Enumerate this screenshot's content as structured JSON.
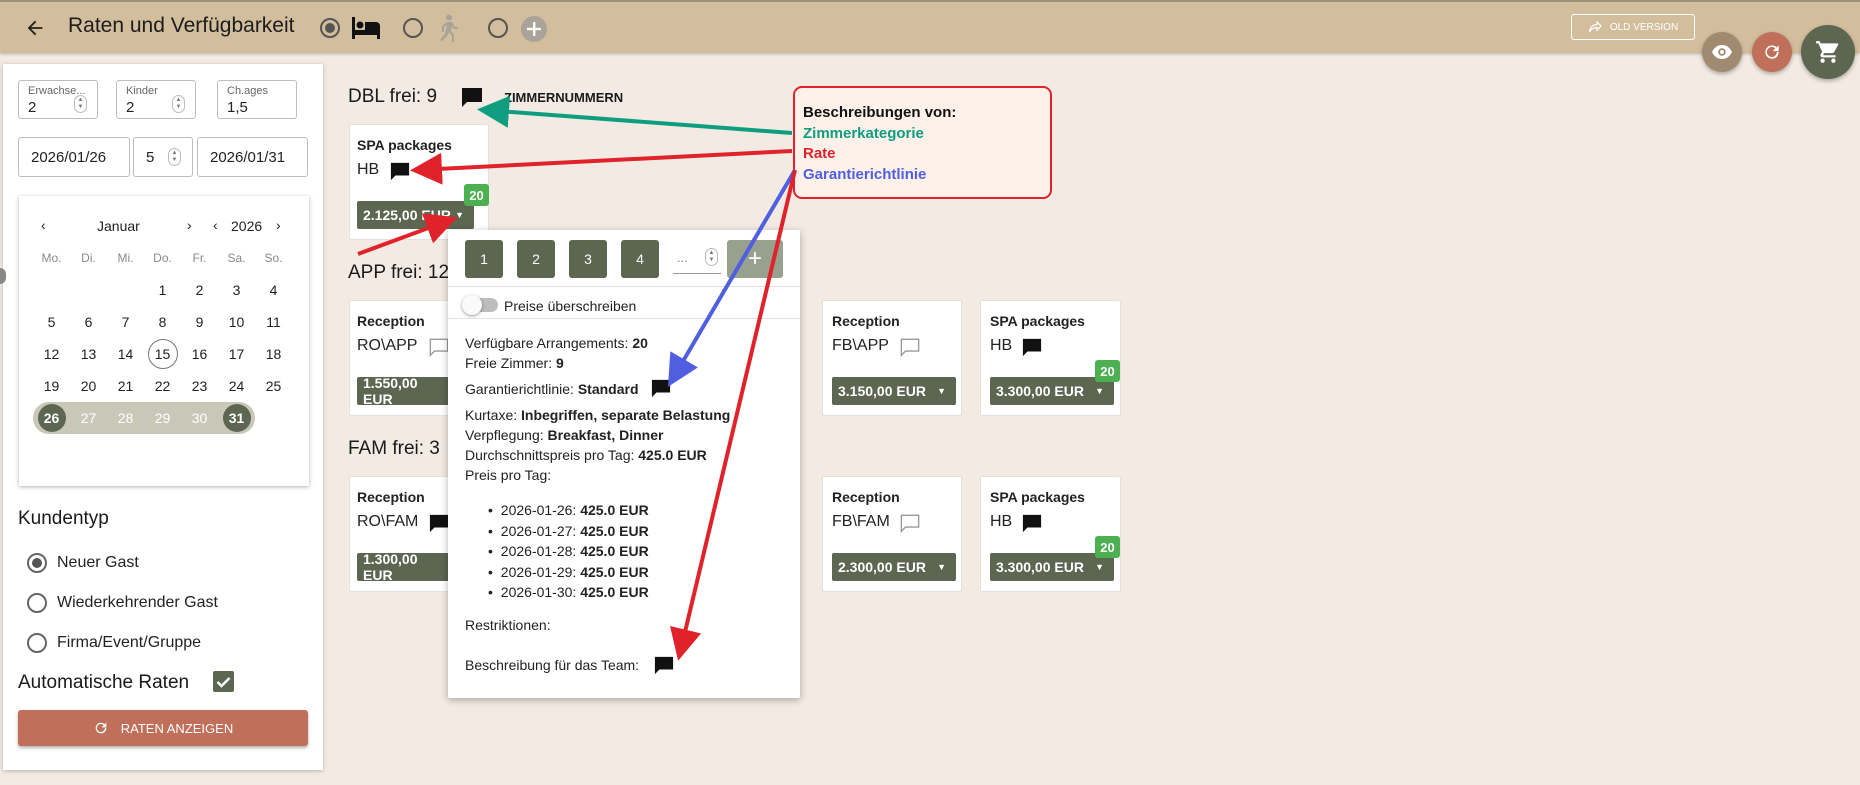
{
  "header": {
    "title": "Raten und Verfügbarkeit",
    "back_icon": "arrow-left-icon",
    "mode_options": [
      {
        "icon": "bed-icon",
        "selected": true
      },
      {
        "icon": "walking-person-icon",
        "selected": false
      },
      {
        "icon": "plus-circle-icon",
        "selected": false
      }
    ],
    "old_version_label": "OLD VERSION",
    "colors": {
      "bar": "#d2be9c",
      "eye_fab": "#a08a70",
      "refresh_fab": "#c0705a",
      "cart_fab": "#5c6651"
    }
  },
  "search": {
    "adults": {
      "label": "Erwachse...",
      "value": "2"
    },
    "children": {
      "label": "Kinder",
      "value": "2"
    },
    "child_ages": {
      "label": "Ch.ages",
      "value": "1,5"
    },
    "arrival": "2026/01/26",
    "nights": "5",
    "departure": "2026/01/31"
  },
  "calendar": {
    "month": "Januar",
    "year": "2026",
    "weekdays": [
      "Mo.",
      "Di.",
      "Mi.",
      "Do.",
      "Fr.",
      "Sa.",
      "So."
    ],
    "weeks": [
      [
        "",
        "",
        "",
        "1",
        "2",
        "3",
        "4"
      ],
      [
        "5",
        "6",
        "7",
        "8",
        "9",
        "10",
        "11"
      ],
      [
        "12",
        "13",
        "14",
        "15",
        "16",
        "17",
        "18"
      ],
      [
        "19",
        "20",
        "21",
        "22",
        "23",
        "24",
        "25"
      ],
      [
        "26",
        "27",
        "28",
        "29",
        "30",
        "31",
        ""
      ]
    ],
    "today": "15",
    "range_start": "26",
    "range_end": "31"
  },
  "customer_type": {
    "title": "Kundentyp",
    "options": [
      {
        "label": "Neuer Gast",
        "selected": true
      },
      {
        "label": "Wiederkehrender Gast",
        "selected": false
      },
      {
        "label": "Firma/Event/Gruppe",
        "selected": false
      }
    ]
  },
  "auto_rates": {
    "label": "Automatische Raten",
    "checked": true
  },
  "show_rates_button": "RATEN ANZEIGEN",
  "categories": {
    "dbl": {
      "title": "DBL frei: 9",
      "room_numbers_label": "ZIMMERNUMMERN",
      "cards": [
        {
          "name": "SPA packages",
          "rate": "HB",
          "price": "2.125,00 EUR",
          "badge": "20"
        }
      ]
    },
    "app": {
      "title": "APP frei: 12",
      "cards": [
        {
          "name": "Reception",
          "rate": "RO\\APP",
          "price": "1.550,00 EUR"
        },
        {
          "name": "Reception",
          "rate": "FB\\APP",
          "price": "3.150,00 EUR"
        },
        {
          "name": "SPA packages",
          "rate": "HB",
          "price": "3.300,00 EUR",
          "badge": "20"
        }
      ]
    },
    "fam": {
      "title": "FAM frei: 3",
      "cards": [
        {
          "name": "Reception",
          "rate": "RO\\FAM",
          "price": "1.300,00 EUR"
        },
        {
          "name": "Reception",
          "rate": "FB\\FAM",
          "price": "2.300,00 EUR"
        },
        {
          "name": "SPA packages",
          "rate": "HB",
          "price": "3.300,00 EUR",
          "badge": "20"
        }
      ]
    }
  },
  "popup": {
    "qty_buttons": [
      "1",
      "2",
      "3",
      "4"
    ],
    "qty_placeholder": "...",
    "override_label": "Preise überschreiben",
    "available_label": "Verfügbare Arrangements:",
    "available_value": "20",
    "free_rooms_label": "Freie Zimmer:",
    "free_rooms_value": "9",
    "guarantee_label": "Garantierichtlinie:",
    "guarantee_value": "Standard",
    "tax_label": "Kurtaxe:",
    "tax_value": "Inbegriffen, separate Belastung",
    "meal_label": "Verpflegung:",
    "meal_value": "Breakfast, Dinner",
    "avg_label": "Durchschnittspreis pro Tag:",
    "avg_value": "425.0 EUR",
    "per_day_label": "Preis pro Tag:",
    "days": [
      {
        "date": "2026-01-26:",
        "price": "425.0 EUR"
      },
      {
        "date": "2026-01-27:",
        "price": "425.0 EUR"
      },
      {
        "date": "2026-01-28:",
        "price": "425.0 EUR"
      },
      {
        "date": "2026-01-29:",
        "price": "425.0 EUR"
      },
      {
        "date": "2026-01-30:",
        "price": "425.0 EUR"
      }
    ],
    "restrictions_label": "Restriktionen:",
    "team_label": "Beschreibung für das Team:"
  },
  "annotation": {
    "title": "Beschreibungen von:",
    "line1": "Zimmerkategorie",
    "line2": "Rate",
    "line3": "Garantierichtlinie",
    "colors": {
      "line1": "#0f9d7f",
      "line2": "#e0232b",
      "line3": "#4f5fe0"
    }
  },
  "theme": {
    "primary": "#5c6651",
    "accent": "#c0705a",
    "badge": "#4caf50",
    "background": "#f3ebe3"
  }
}
